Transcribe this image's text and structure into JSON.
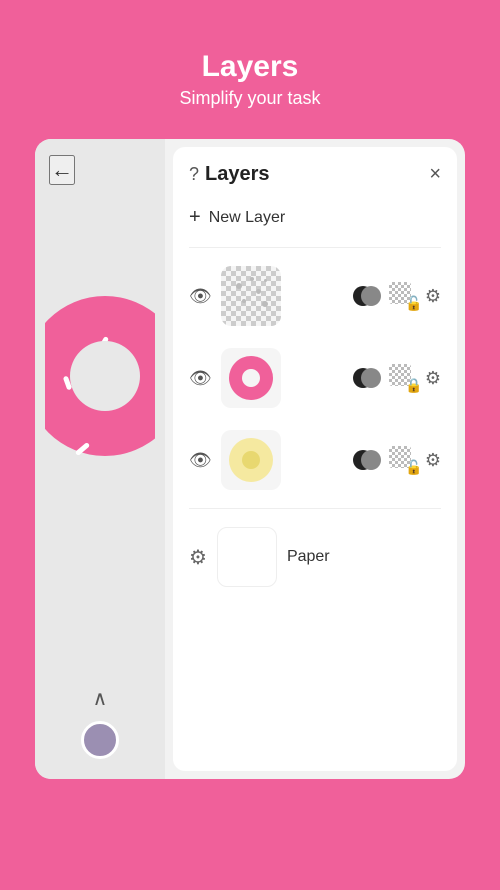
{
  "header": {
    "title": "Layers",
    "subtitle": "Simplify your task"
  },
  "panel": {
    "title": "Layers",
    "help_label": "?",
    "close_label": "×",
    "new_layer_label": "New Layer",
    "new_layer_plus": "+"
  },
  "layers": [
    {
      "id": "layer1",
      "visible": true,
      "type": "scatter",
      "label": ""
    },
    {
      "id": "layer2",
      "visible": true,
      "type": "donut",
      "label": ""
    },
    {
      "id": "layer3",
      "visible": true,
      "type": "yellow",
      "label": ""
    },
    {
      "id": "paper",
      "visible": false,
      "type": "paper",
      "label": "Paper"
    }
  ],
  "controls": {
    "back_label": "←",
    "chevron_up_label": "∧"
  },
  "colors": {
    "background": "#F0609A",
    "panel_bg": "white",
    "avatar_color": "#9B8FB2"
  }
}
